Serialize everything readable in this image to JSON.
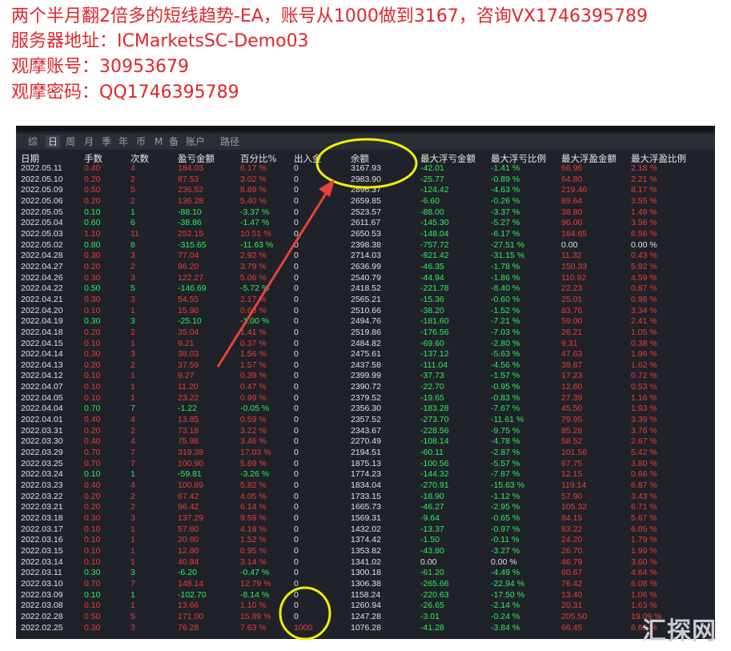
{
  "headlines": [
    "两个半月翻2倍多的短线趋势-EA，账号从1000做到3167，咨询VX1746395789",
    "服务器地址：ICMarketsSC-Demo03",
    "观摩账号：30953679",
    "观摩密码：QQ1746395789"
  ],
  "tabs": [
    "综",
    "日",
    "周",
    "月",
    "季",
    "年",
    "币",
    "M",
    "备",
    "账户",
    "路径"
  ],
  "active_tab": "日",
  "columns": [
    "日期",
    "手数",
    "次数",
    "盈亏金额",
    "百分比%",
    "出入金",
    "余额",
    "最大浮亏金额",
    "最大浮亏比例",
    "最大浮盈金额",
    "最大浮盈比例"
  ],
  "colors": {
    "positive": "#ef3b3b",
    "negative": "#2df05e",
    "neutral": "#dfe3e8",
    "annotation": "#f5ef00",
    "arrow": "#e8433a"
  },
  "rows": [
    [
      "2022.05.11",
      "0.40",
      "4",
      "184.03",
      "6.17 %",
      "0",
      "3167.93",
      "-42.01",
      "-1.41 %",
      "66.96",
      "2.18 %"
    ],
    [
      "2022.05.10",
      "0.20",
      "2",
      "87.53",
      "3.02 %",
      "0",
      "2983.90",
      "-25.77",
      "-0.89 %",
      "64.80",
      "2.21 %"
    ],
    [
      "2022.05.09",
      "0.50",
      "5",
      "236.52",
      "8.89 %",
      "0",
      "2896.37",
      "-124.42",
      "-4.63 %",
      "219.46",
      "8.17 %"
    ],
    [
      "2022.05.06",
      "0.20",
      "2",
      "136.28",
      "5.40 %",
      "0",
      "2659.85",
      "-6.60",
      "-0.26 %",
      "89.64",
      "3.55 %"
    ],
    [
      "2022.05.05",
      "0.10",
      "1",
      "-88.10",
      "-3.37 %",
      "0",
      "2523.57",
      "-88.00",
      "-3.37 %",
      "38.80",
      "1.49 %"
    ],
    [
      "2022.05.04",
      "0.60",
      "6",
      "-38.86",
      "-1.47 %",
      "0",
      "2611.67",
      "-145.30",
      "-5.27 %",
      "96.00",
      "3.56 %"
    ],
    [
      "2022.05.03",
      "1.10",
      "11",
      "252.15",
      "10.51 %",
      "0",
      "2650.53",
      "-148.04",
      "-6.17 %",
      "164.65",
      "6.56 %"
    ],
    [
      "2022.05.02",
      "0.80",
      "8",
      "-315.65",
      "-11.63 %",
      "0",
      "2398.38",
      "-757.72",
      "-27.51 %",
      "0.00",
      "0.00 %"
    ],
    [
      "2022.04.28",
      "0.30",
      "3",
      "77.04",
      "2.92 %",
      "0",
      "2714.03",
      "-821.42",
      "-31.15 %",
      "11.32",
      "0.43 %"
    ],
    [
      "2022.04.27",
      "0.20",
      "2",
      "96.20",
      "3.79 %",
      "0",
      "2636.99",
      "-46.35",
      "-1.78 %",
      "150.33",
      "5.92 %"
    ],
    [
      "2022.04.26",
      "0.30",
      "3",
      "122.27",
      "5.06 %",
      "0",
      "2540.79",
      "-44.94",
      "-1.86 %",
      "110.92",
      "4.59 %"
    ],
    [
      "2022.04.22",
      "0.50",
      "5",
      "-146.69",
      "-5.72 %",
      "0",
      "2418.52",
      "-221.78",
      "-8.40 %",
      "22.23",
      "0.87 %"
    ],
    [
      "2022.04.21",
      "0.30",
      "3",
      "54.55",
      "2.17 %",
      "0",
      "2565.21",
      "-15.36",
      "-0.60 %",
      "25.01",
      "0.98 %"
    ],
    [
      "2022.04.20",
      "0.10",
      "1",
      "15.90",
      "0.63 %",
      "0",
      "2510.66",
      "-38.20",
      "-1.52 %",
      "83.76",
      "3.34 %"
    ],
    [
      "2022.04.19",
      "0.30",
      "3",
      "-25.10",
      "-1.00 %",
      "0",
      "2494.76",
      "-181.60",
      "-7.21 %",
      "59.00",
      "2.41 %"
    ],
    [
      "2022.04.18",
      "0.20",
      "2",
      "35.04",
      "1.41 %",
      "0",
      "2519.86",
      "-176.56",
      "-7.03 %",
      "26.21",
      "1.05 %"
    ],
    [
      "2022.04.15",
      "0.10",
      "1",
      "9.21",
      "0.37 %",
      "0",
      "2484.82",
      "-69.60",
      "-2.80 %",
      "9.31",
      "0.38 %"
    ],
    [
      "2022.04.14",
      "0.30",
      "3",
      "38.03",
      "1.56 %",
      "0",
      "2475.61",
      "-137.12",
      "-5.63 %",
      "47.63",
      "1.96 %"
    ],
    [
      "2022.04.13",
      "0.20",
      "2",
      "37.59",
      "1.57 %",
      "0",
      "2437.58",
      "-111.04",
      "-4.56 %",
      "38.87",
      "1.62 %"
    ],
    [
      "2022.04.12",
      "0.10",
      "1",
      "9.27",
      "0.39 %",
      "0",
      "2399.99",
      "-37.73",
      "-1.57 %",
      "17.23",
      "0.72 %"
    ],
    [
      "2022.04.07",
      "0.10",
      "1",
      "11.20",
      "0.47 %",
      "0",
      "2390.72",
      "-22.70",
      "-0.95 %",
      "12.60",
      "0.53 %"
    ],
    [
      "2022.04.05",
      "0.10",
      "1",
      "23.22",
      "0.99 %",
      "0",
      "2379.52",
      "-19.65",
      "-0.83 %",
      "27.39",
      "1.16 %"
    ],
    [
      "2022.04.04",
      "0.70",
      "7",
      "-1.22",
      "-0.05 %",
      "0",
      "2356.30",
      "-183.28",
      "-7.67 %",
      "45.50",
      "1.93 %"
    ],
    [
      "2022.04.01",
      "0.40",
      "4",
      "13.85",
      "0.59 %",
      "0",
      "2357.52",
      "-273.70",
      "-11.61 %",
      "79.95",
      "3.39 %"
    ],
    [
      "2022.03.31",
      "0.20",
      "2",
      "73.18",
      "3.22 %",
      "0",
      "2343.67",
      "-228.56",
      "-9.75 %",
      "85.28",
      "3.76 %"
    ],
    [
      "2022.03.30",
      "0.40",
      "4",
      "75.98",
      "3.46 %",
      "0",
      "2270.49",
      "-108.14",
      "-4.78 %",
      "58.52",
      "2.67 %"
    ],
    [
      "2022.03.29",
      "0.70",
      "7",
      "319.38",
      "17.03 %",
      "0",
      "2194.51",
      "-60.11",
      "-2.87 %",
      "101.56",
      "5.42 %"
    ],
    [
      "2022.03.25",
      "0.70",
      "7",
      "100.90",
      "5.69 %",
      "0",
      "1875.13",
      "-100.56",
      "-5.57 %",
      "67.75",
      "3.80 %"
    ],
    [
      "2022.03.24",
      "0.10",
      "1",
      "-59.81",
      "-3.26 %",
      "0",
      "1774.23",
      "-144.32",
      "-7.87 %",
      "12.15",
      "0.66 %"
    ],
    [
      "2022.03.23",
      "0.40",
      "4",
      "100.89",
      "5.82 %",
      "0",
      "1834.04",
      "-270.91",
      "-15.63 %",
      "119.14",
      "6.87 %"
    ],
    [
      "2022.03.22",
      "0.20",
      "2",
      "67.42",
      "4.05 %",
      "0",
      "1733.15",
      "-18.90",
      "-1.12 %",
      "57.90",
      "3.43 %"
    ],
    [
      "2022.03.21",
      "0.20",
      "2",
      "96.42",
      "6.14 %",
      "0",
      "1665.73",
      "-46.27",
      "-2.95 %",
      "105.32",
      "6.71 %"
    ],
    [
      "2022.03.18",
      "0.30",
      "3",
      "137.29",
      "9.59 %",
      "0",
      "1569.31",
      "-9.64",
      "-0.65 %",
      "84.15",
      "5.67 %"
    ],
    [
      "2022.03.17",
      "0.10",
      "1",
      "57.60",
      "4.19 %",
      "0",
      "1432.02",
      "-13.37",
      "-0.97 %",
      "83.22",
      "6.05 %"
    ],
    [
      "2022.03.16",
      "0.10",
      "1",
      "20.60",
      "1.52 %",
      "0",
      "1374.42",
      "-1.50",
      "-0.11 %",
      "24.20",
      "1.79 %"
    ],
    [
      "2022.03.15",
      "0.10",
      "1",
      "12.80",
      "0.95 %",
      "0",
      "1353.82",
      "-43.80",
      "-3.27 %",
      "26.70",
      "1.99 %"
    ],
    [
      "2022.03.14",
      "0.10",
      "1",
      "40.84",
      "3.14 %",
      "0",
      "1341.02",
      "0.00",
      "0.00 %",
      "46.79",
      "3.60 %"
    ],
    [
      "2022.03.11",
      "0.30",
      "3",
      "-6.20",
      "-0.47 %",
      "0",
      "1300.18",
      "-61.20",
      "-4.49 %",
      "60.67",
      "4.64 %"
    ],
    [
      "2022.03.10",
      "0.70",
      "7",
      "148.14",
      "12.79 %",
      "0",
      "1306.38",
      "-265.66",
      "-22.94 %",
      "76.42",
      "6.08 %"
    ],
    [
      "2022.03.09",
      "0.10",
      "1",
      "-102.70",
      "-8.14 %",
      "0",
      "1158.24",
      "-220.63",
      "-17.50 %",
      "13.40",
      "1.06 %"
    ],
    [
      "2022.03.08",
      "0.10",
      "1",
      "13.66",
      "1.10 %",
      "0",
      "1260.94",
      "-26.65",
      "-2.14 %",
      "20.31",
      "1.63 %"
    ],
    [
      "2022.02.28",
      "0.50",
      "5",
      "171.00",
      "15.89 %",
      "0",
      "1247.28",
      "-3.01",
      "-0.24 %",
      "205.50",
      "19.09 %"
    ],
    [
      "2022.02.25",
      "0.30",
      "3",
      "76.28",
      "7.63 %",
      "1000",
      "1076.28",
      "-41.28",
      "-3.84 %",
      "66.45",
      "6.65 %"
    ]
  ],
  "watermark": "汇探网"
}
